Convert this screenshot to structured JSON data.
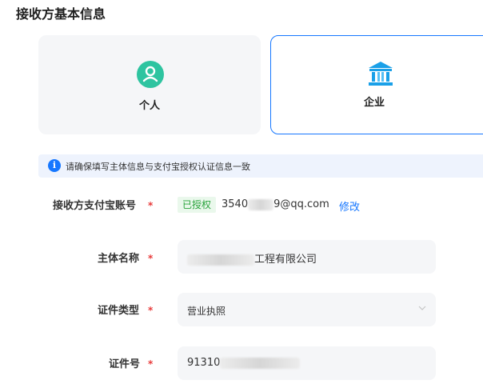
{
  "section": {
    "title": "接收方基本信息"
  },
  "types": [
    {
      "label": "个人",
      "icon": "person-icon",
      "selected": false
    },
    {
      "label": "企业",
      "icon": "bank-building-icon",
      "selected": true
    }
  ],
  "notice": {
    "icon": "info-icon",
    "text": "请确保填写主体信息与支付宝授权认证信息一致"
  },
  "form": {
    "account": {
      "label": "接收方支付宝账号",
      "required": "*",
      "tag": "已授权",
      "value_prefix": "3540",
      "value_suffix": "9@qq.com",
      "action": "修改"
    },
    "entity_name": {
      "label": "主体名称",
      "required": "*",
      "value_suffix": "工程有限公司"
    },
    "cert_type": {
      "label": "证件类型",
      "required": "*",
      "value": "营业执照",
      "icon": "chevron-down-icon"
    },
    "cert_no": {
      "label": "证件号",
      "required": "*",
      "value_prefix": "91310"
    }
  },
  "colors": {
    "accent": "#1677ff",
    "required": "#e83a3a",
    "tag_text": "#2aa33c",
    "tag_bg": "#eaf8ec",
    "personal_icon": "#2ec4a0",
    "company_icon": "#1aa0e8"
  }
}
